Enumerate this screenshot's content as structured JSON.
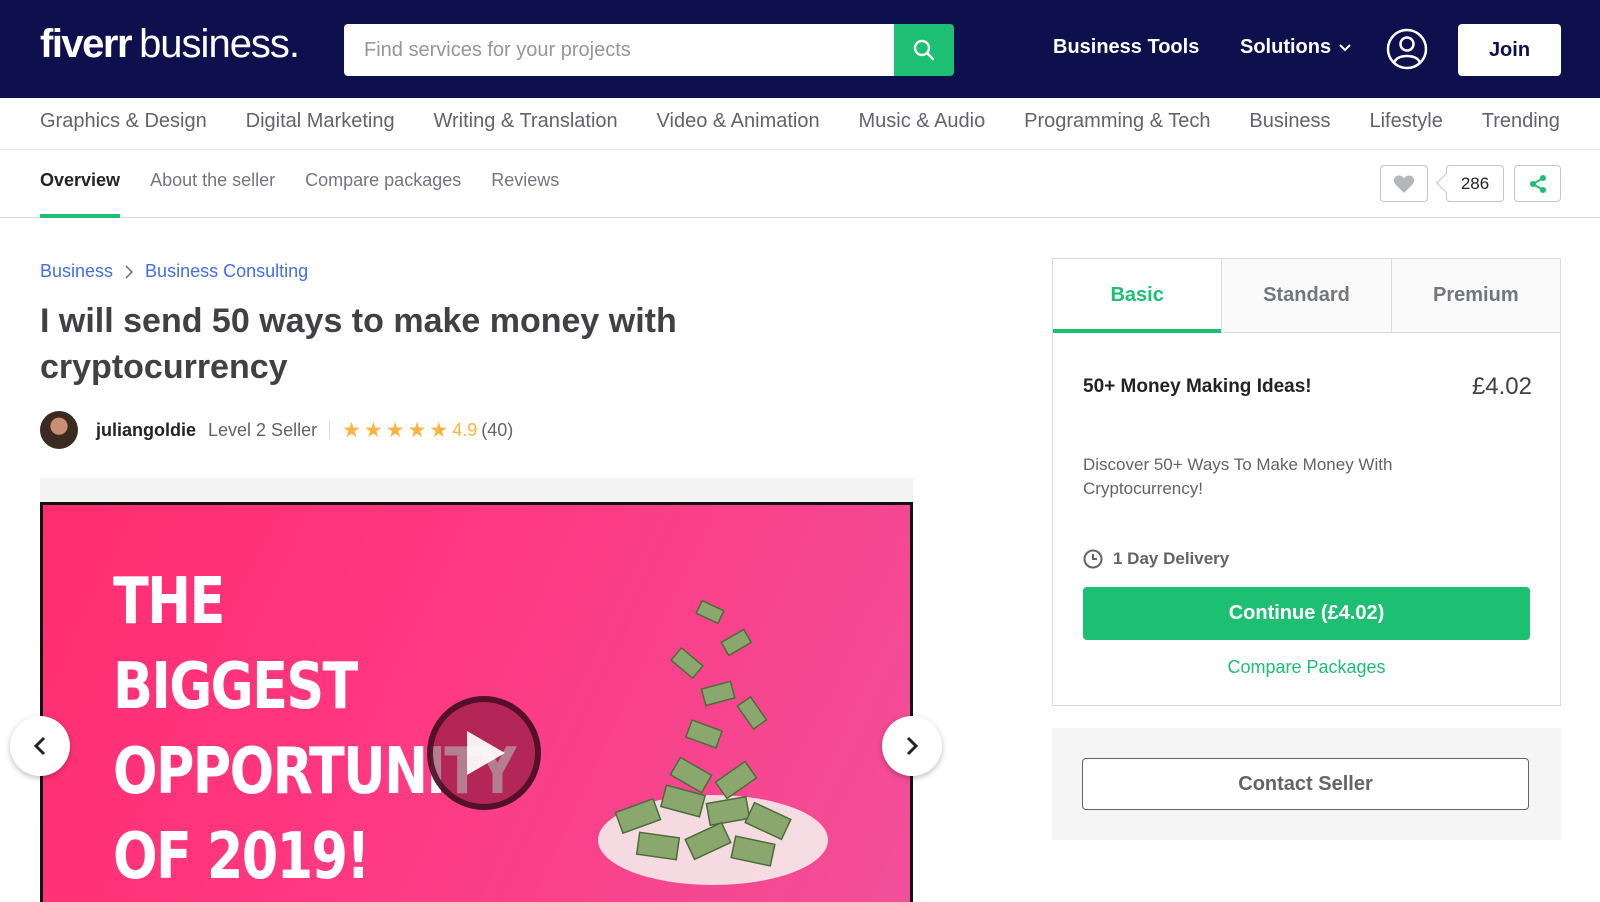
{
  "header": {
    "logo_main": "fiverr",
    "logo_sub": "business.",
    "search_placeholder": "Find services for your projects",
    "business_tools": "Business Tools",
    "solutions": "Solutions",
    "join": "Join"
  },
  "categories": [
    "Graphics & Design",
    "Digital Marketing",
    "Writing & Translation",
    "Video & Animation",
    "Music & Audio",
    "Programming & Tech",
    "Business",
    "Lifestyle",
    "Trending"
  ],
  "subnav": {
    "tabs": [
      "Overview",
      "About the seller",
      "Compare packages",
      "Reviews"
    ],
    "favorites_count": "286"
  },
  "breadcrumb": [
    "Business",
    "Business Consulting"
  ],
  "gig": {
    "title": "I will send 50 ways to make money with cryptocurrency",
    "seller_name": "juliangoldie",
    "seller_level": "Level 2 Seller",
    "rating": "4.9",
    "reviews": "(40)",
    "star_count": 5
  },
  "gallery": {
    "slide_lines": [
      "THE",
      "BIGGEST",
      "OPPORTUNITY",
      "OF 2019!"
    ]
  },
  "package": {
    "tabs": [
      "Basic",
      "Standard",
      "Premium"
    ],
    "name": "50+ Money Making Ideas!",
    "price": "£4.02",
    "description": "Discover 50+ Ways To Make Money With Cryptocurrency!",
    "delivery": "1 Day Delivery",
    "continue": "Continue (£4.02)",
    "compare": "Compare Packages"
  },
  "contact": {
    "label": "Contact Seller"
  },
  "colors": {
    "navy": "#0e0f4d",
    "green": "#1dbf73",
    "star": "#ffb33e",
    "link": "#446ee7"
  }
}
